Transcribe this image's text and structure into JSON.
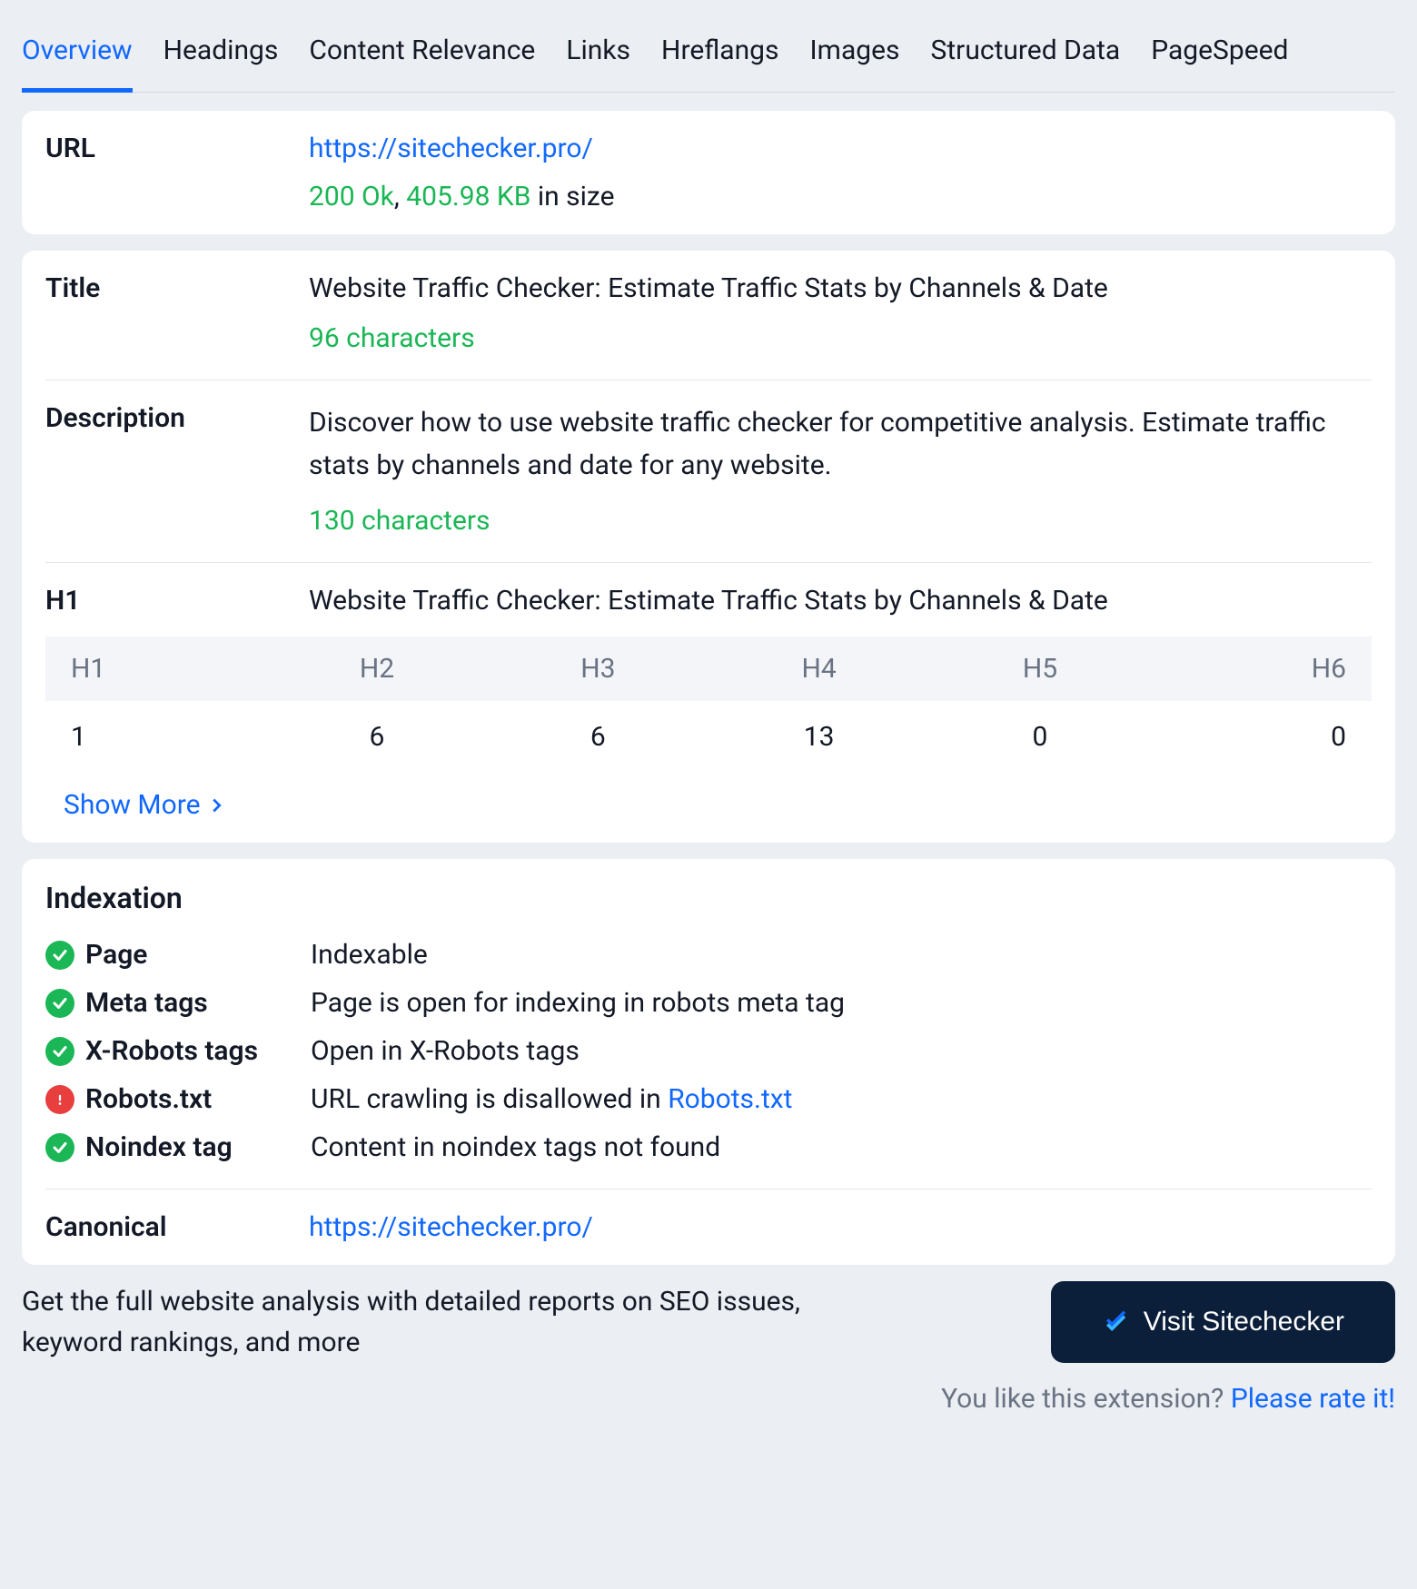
{
  "tabs": [
    "Overview",
    "Headings",
    "Content Relevance",
    "Links",
    "Hreflangs",
    "Images",
    "Structured Data",
    "PageSpeed"
  ],
  "url": {
    "label": "URL",
    "value": "https://sitechecker.pro/",
    "status_code": "200 Ok",
    "sep": ", ",
    "size": "405.98 KB",
    "size_suffix": " in size"
  },
  "title": {
    "label": "Title",
    "text": "Website Traffic Checker: Estimate Traffic Stats by Channels & Date",
    "chars": "96 characters"
  },
  "description": {
    "label": "Description",
    "text": "Discover how to use website traffic checker for competitive analysis. Estimate traffic stats by channels and date for any website.",
    "chars": "130 characters"
  },
  "h1": {
    "label": "H1",
    "text": "Website Traffic Checker: Estimate Traffic Stats by Channels & Date"
  },
  "headings_table": {
    "headers": [
      "H1",
      "H2",
      "H3",
      "H4",
      "H5",
      "H6"
    ],
    "counts": [
      "1",
      "6",
      "6",
      "13",
      "0",
      "0"
    ]
  },
  "show_more": "Show More",
  "indexation": {
    "title": "Indexation",
    "items": [
      {
        "ok": true,
        "label": "Page",
        "value": "Indexable"
      },
      {
        "ok": true,
        "label": "Meta tags",
        "value": "Page is open for indexing in robots meta tag"
      },
      {
        "ok": true,
        "label": "X-Robots tags",
        "value": "Open in X-Robots tags"
      },
      {
        "ok": false,
        "label": "Robots.txt",
        "value_prefix": "URL crawling is disallowed in ",
        "value_link": "Robots.txt"
      },
      {
        "ok": true,
        "label": "Noindex tag",
        "value": "Content in noindex tags not found"
      }
    ],
    "canonical_label": "Canonical",
    "canonical_url": "https://sitechecker.pro/"
  },
  "footer": {
    "text": "Get the full website analysis with detailed reports on SEO issues, keyword rankings, and more",
    "cta": "Visit Sitechecker",
    "rate_prefix": "You like this extension? ",
    "rate_link": "Please rate it!"
  }
}
